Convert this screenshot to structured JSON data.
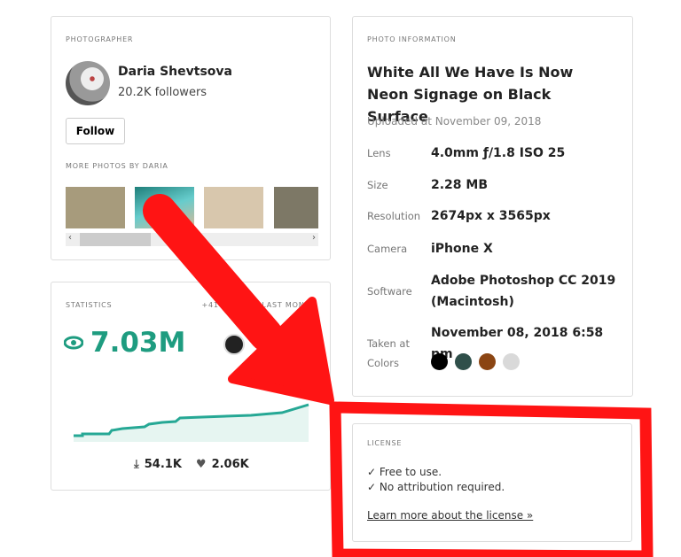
{
  "photographer": {
    "caption": "PHOTOGRAPHER",
    "name": "Daria Shevtsova",
    "followers": "20.2K followers",
    "follow_label": "Follow",
    "more_caption": "MORE PHOTOS BY DARIA",
    "thumbs": [
      "#a79b7c",
      "#3a9a92",
      "#d8c7ad",
      "#7d7866"
    ]
  },
  "stats": {
    "caption": "STATISTICS",
    "delta": "+414K VIEWS LAST MONTH",
    "views": "7.03M",
    "downloads": "54.1K",
    "likes": "2.06K",
    "accent": "#1e9c80"
  },
  "info": {
    "caption": "PHOTO INFORMATION",
    "title": "White All We Have Is Now Neon Signage on Black Surface",
    "uploaded": "Uploaded at November 09, 2018",
    "rows": [
      {
        "k": "Lens",
        "v": "4.0mm ƒ/1.8 ISO 25"
      },
      {
        "k": "Size",
        "v": "2.28 MB"
      },
      {
        "k": "Resolution",
        "v": "2674px x 3565px"
      },
      {
        "k": "Camera",
        "v": "iPhone X"
      },
      {
        "k": "Software",
        "v": "Adobe Photoshop CC 2019 (Macintosh)"
      },
      {
        "k": "Taken at",
        "v": "November 08, 2018 6:58 pm"
      }
    ],
    "colors_label": "Colors",
    "colors": [
      "#000000",
      "#2f4f4a",
      "#8b4513",
      "#d9d9d9"
    ]
  },
  "license": {
    "caption": "LICENSE",
    "line1": "✓ Free to use.",
    "line2": "✓ No attribution required.",
    "link": "Learn more about the license »"
  },
  "annotation": {
    "color": "#ff1414"
  }
}
